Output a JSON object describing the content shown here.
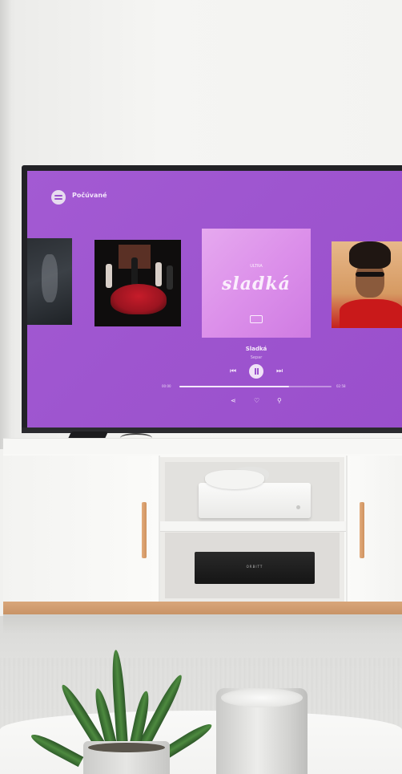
{
  "screen": {
    "app_title": "Počúvané",
    "accent_color": "#9e55cf",
    "covers": [
      {
        "name": "cover-left-partial"
      },
      {
        "name": "cover-red-dress"
      },
      {
        "name": "cover-featured",
        "small": "ULTRA",
        "title": "sladká"
      },
      {
        "name": "cover-portrait"
      }
    ],
    "now_playing": {
      "title": "Sladká",
      "artist": "Separ",
      "elapsed": "00:00",
      "total": "02:58",
      "progress": 0.72
    },
    "controls": {
      "prev_icon": "⏮",
      "next_icon": "⏭",
      "share_icon": "⋖",
      "heart_icon": "♡",
      "pin_icon": "⚲"
    }
  },
  "cabinet": {
    "soundbar_label": "ORBITT"
  }
}
